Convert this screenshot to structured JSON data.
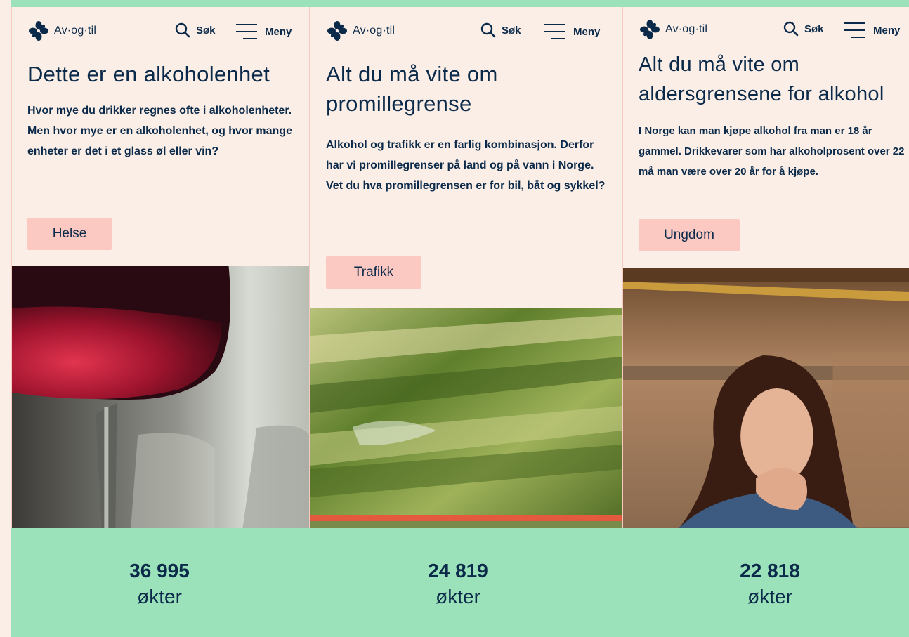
{
  "brand": {
    "name": "Av·og·til"
  },
  "header": {
    "search_label": "Søk",
    "menu_label": "Meny"
  },
  "cards": [
    {
      "title": "Dette er en alkoholenhet",
      "description": "Hvor mye du drikker regnes ofte i alkoholenheter. Men hvor mye er en alkoholenhet, og hvor mange enheter er det i et glass øl eller vin?",
      "tag": "Helse",
      "stat_value": "36 995",
      "stat_unit": "økter"
    },
    {
      "title": "Alt du må vite om promillegrense",
      "description": "Alkohol og trafikk er en farlig kombinasjon. Derfor har vi promillegrenser på land og på vann i Norge. Vet du hva promillegrensen er for bil, båt og sykkel?",
      "tag": "Trafikk",
      "stat_value": "24 819",
      "stat_unit": "økter"
    },
    {
      "title": "Alt du må vite om aldersgrensene for alkohol",
      "description": "I Norge kan man kjøpe alkohol fra man er 18 år gammel. Drikkevarer som har alkoholprosent over 22 må man være over 20 år for å kjøpe.",
      "tag": "Ungdom",
      "stat_value": "22 818",
      "stat_unit": "økter"
    }
  ],
  "colors": {
    "background": "#9be2bb",
    "card": "#fbeee6",
    "tag": "#fcc9c2",
    "text": "#0b2a4a"
  }
}
